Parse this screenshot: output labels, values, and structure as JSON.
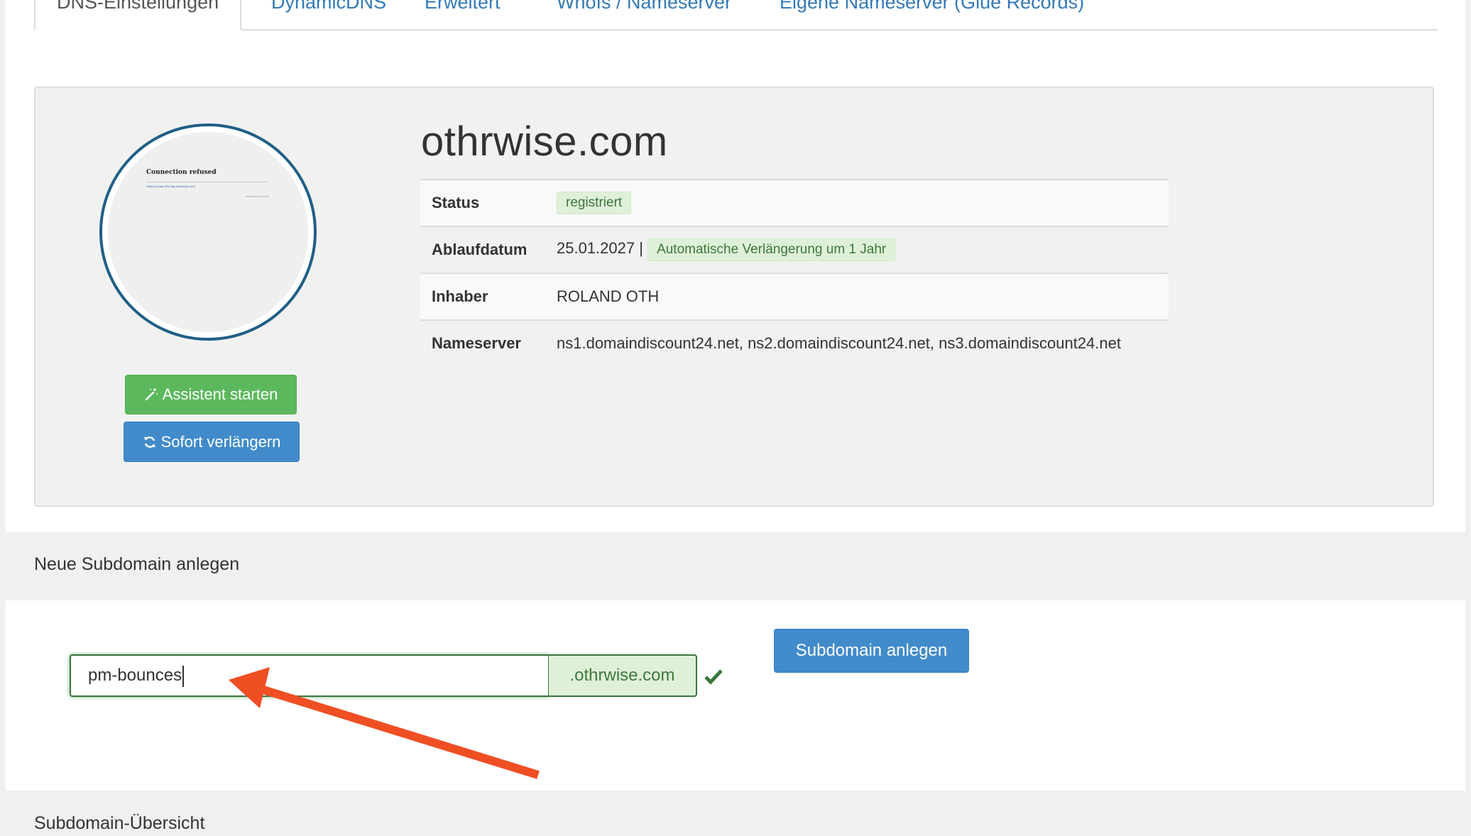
{
  "tabs": [
    {
      "label": "DNS-Einstellungen",
      "active": true
    },
    {
      "label": "DynamicDNS"
    },
    {
      "label": "Erweitert"
    },
    {
      "label": "WhoIs / Nameserver"
    },
    {
      "label": "Eigene Nameserver (Glue Records)"
    }
  ],
  "preview": {
    "title": "Connection refused",
    "text": "Failed to load URL http://othrwise.com/",
    "small": "screenshot service"
  },
  "buttons": {
    "assistant": "Assistent starten",
    "renew": "Sofort verlängern",
    "create_subdomain": "Subdomain anlegen"
  },
  "domain": {
    "name": "othrwise.com",
    "rows": [
      {
        "key": "Status",
        "value": "",
        "badge": "registriert"
      },
      {
        "key": "Ablaufdatum",
        "value": "25.01.2027 |",
        "badge": "Automatische Verlängerung um 1 Jahr"
      },
      {
        "key": "Inhaber",
        "value": "ROLAND OTH"
      },
      {
        "key": "Nameserver",
        "value": "ns1.domaindiscount24.net, ns2.domaindiscount24.net, ns3.domaindiscount24.net"
      }
    ]
  },
  "new_subdomain": {
    "section_title": "Neue Subdomain anlegen",
    "input_value": "pm-bounces",
    "suffix": ".othrwise.com"
  },
  "overview": {
    "section_title": "Subdomain-Übersicht"
  },
  "colors": {
    "link": "#337ab7",
    "success_green": "#5cb85c",
    "primary_blue": "#428bca",
    "valid_green": "#3c763d",
    "annotation_arrow": "#f04e23"
  },
  "icons": {
    "assistant": "magic-wand-icon",
    "renew": "refresh-icon",
    "valid": "checkmark-icon"
  }
}
